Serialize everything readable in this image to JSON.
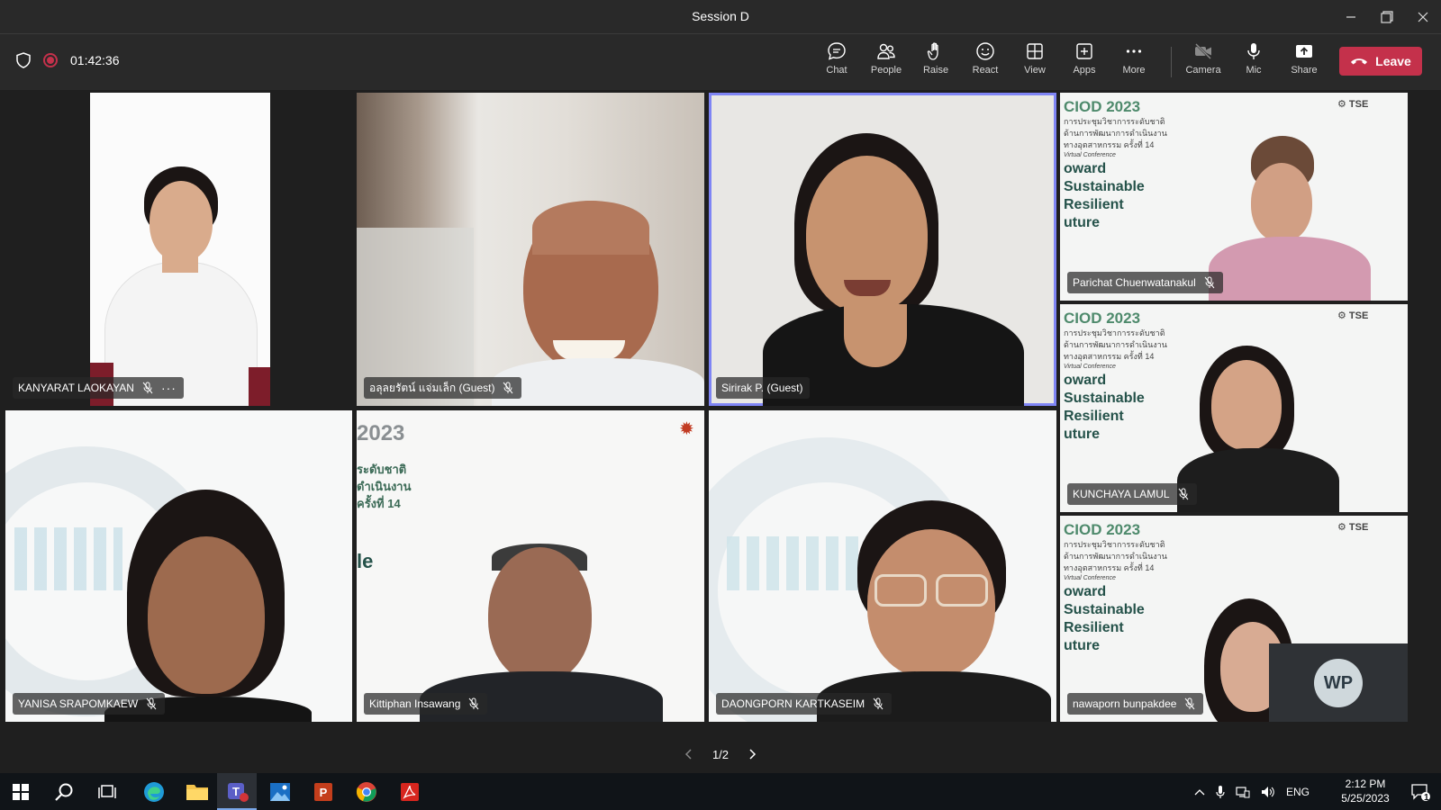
{
  "window": {
    "title": "Session D"
  },
  "toolbar": {
    "timer": "01:42:36",
    "buttons": [
      {
        "label": "Chat",
        "icon": "chat-icon"
      },
      {
        "label": "People",
        "icon": "people-icon"
      },
      {
        "label": "Raise",
        "icon": "raise-hand-icon"
      },
      {
        "label": "React",
        "icon": "react-smiley-icon"
      },
      {
        "label": "View",
        "icon": "view-grid-icon"
      },
      {
        "label": "Apps",
        "icon": "apps-plus-icon"
      },
      {
        "label": "More",
        "icon": "more-dots-icon"
      },
      {
        "label": "Camera",
        "icon": "camera-off-icon"
      },
      {
        "label": "Mic",
        "icon": "mic-icon"
      },
      {
        "label": "Share",
        "icon": "share-icon"
      }
    ],
    "leave_label": "Leave"
  },
  "participants": [
    {
      "name": "KANYARAT LAOKAYAN"
    },
    {
      "name": "อลุลยรัตน์ แจ่มเล็ก (Guest)"
    },
    {
      "name": "Sirirak P. (Guest)"
    },
    {
      "name": "Parichat Chuenwatanakul"
    },
    {
      "name": "KUNCHAYA LAMUL"
    },
    {
      "name": "YANISA SRAPOMKAEW"
    },
    {
      "name": "Kittiphan Insawang"
    },
    {
      "name": "DAONGPORN KARTKASEIM"
    },
    {
      "name": "nawaporn bunpakdee"
    }
  ],
  "banner": {
    "title": "CIOD 2023",
    "title_partial": "2023",
    "tse": "TSE",
    "thai_lines": [
      "การประชุมวิชาการระดับชาติ",
      "ด้านการพัฒนาการดำเนินงาน",
      "ทางอุตสาหกรรม ครั้งที่ 14"
    ],
    "thai_partial": [
      "ระดับชาติ",
      "ดำเนินงาน",
      "ครั้งที่ 14"
    ],
    "sub": "Virtual Conference",
    "slogan": [
      "oward",
      "Sustainable",
      "Resilient",
      "uture"
    ],
    "slogan_partial": "le"
  },
  "avatar_initials": "WP",
  "pager": {
    "text": "1/2"
  },
  "taskbar": {
    "lang": "ENG",
    "time": "2:12 PM",
    "date": "5/25/2023",
    "notifications": "1",
    "apps": [
      "start-icon",
      "search-icon",
      "task-view-icon",
      "edge-icon",
      "file-explorer-icon",
      "teams-icon",
      "photos-icon",
      "powerpoint-icon",
      "chrome-icon",
      "acrobat-icon"
    ]
  },
  "colors": {
    "accent_leave": "#c4314b",
    "active_speaker": "#7f85f5",
    "bg": "#1f1f1f"
  }
}
